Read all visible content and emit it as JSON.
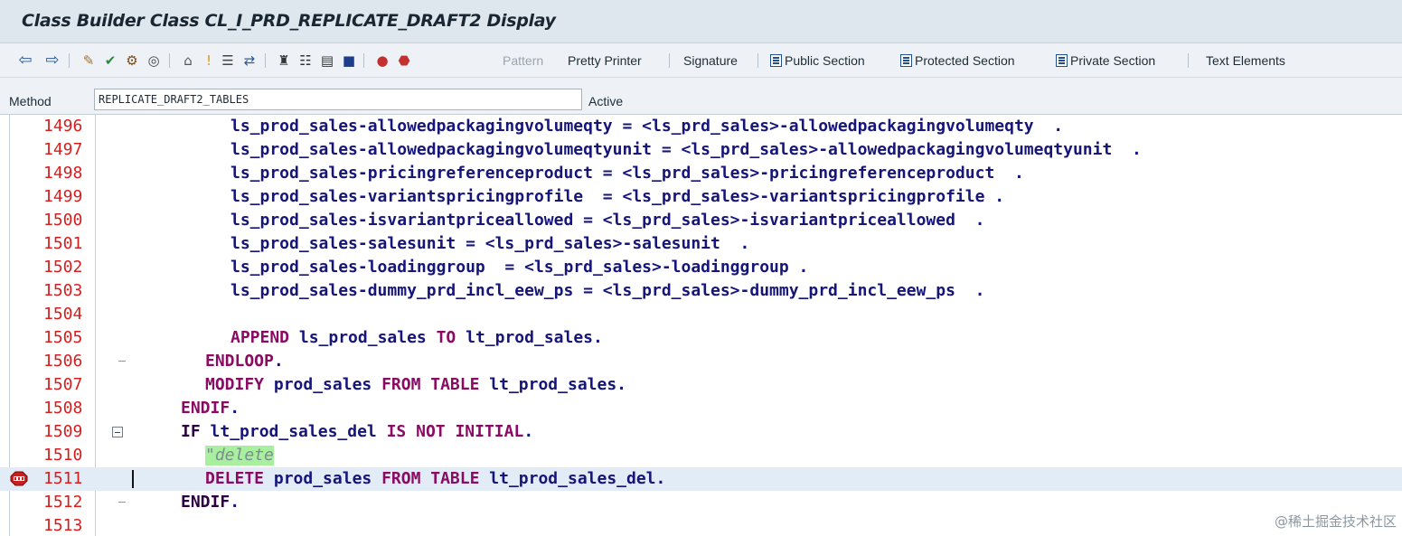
{
  "window": {
    "title": "Class Builder Class CL_I_PRD_REPLICATE_DRAFT2 Display"
  },
  "toolbar": {
    "pattern": "Pattern",
    "pretty_printer": "Pretty Printer",
    "signature": "Signature",
    "public_section": "Public Section",
    "protected_section": "Protected Section",
    "private_section": "Private Section",
    "text_elements": "Text Elements"
  },
  "method": {
    "label": "Method",
    "value": "REPLICATE_DRAFT2_TABLES",
    "status": "Active"
  },
  "code": {
    "lines": [
      {
        "num": "1496",
        "text": "ls_prod_sales-allowedpackagingvolumeqty = <ls_prd_sales>-allowedpackagingvolumeqty  ."
      },
      {
        "num": "1497",
        "text": "ls_prod_sales-allowedpackagingvolumeqtyunit = <ls_prd_sales>-allowedpackagingvolumeqtyunit  ."
      },
      {
        "num": "1498",
        "text": "ls_prod_sales-pricingreferenceproduct = <ls_prd_sales>-pricingreferenceproduct  ."
      },
      {
        "num": "1499",
        "text": "ls_prod_sales-variantspricingprofile  = <ls_prd_sales>-variantspricingprofile ."
      },
      {
        "num": "1500",
        "text": "ls_prod_sales-isvariantpriceallowed = <ls_prd_sales>-isvariantpriceallowed  ."
      },
      {
        "num": "1501",
        "text": "ls_prod_sales-salesunit = <ls_prd_sales>-salesunit  ."
      },
      {
        "num": "1502",
        "text": "ls_prod_sales-loadinggroup  = <ls_prd_sales>-loadinggroup ."
      },
      {
        "num": "1503",
        "text": "ls_prod_sales-dummy_prd_incl_eew_ps = <ls_prd_sales>-dummy_prd_incl_eew_ps  ."
      },
      {
        "num": "1504",
        "text": ""
      },
      {
        "num": "1505",
        "kw1": "APPEND",
        "t1": " ls_prod_sales ",
        "kw2": "TO",
        "t2": " lt_prod_sales."
      },
      {
        "num": "1506",
        "kw1": "ENDLOOP",
        "t1": "."
      },
      {
        "num": "1507",
        "kw1": "MODIFY",
        "t1": " prod_sales ",
        "kw2": "FROM TABLE",
        "t2": " lt_prod_sales."
      },
      {
        "num": "1508",
        "kw1": "ENDIF",
        "t1": "."
      },
      {
        "num": "1509",
        "kw1": "IF",
        "t1": " lt_prod_sales_del ",
        "kw2": "IS NOT INITIAL",
        "t2": "."
      },
      {
        "num": "1510",
        "comment": "\"delete"
      },
      {
        "num": "1511",
        "kw1": "DELETE",
        "t1": " prod_sales ",
        "kw2": "FROM TABLE",
        "t2": " lt_prod_sales_del."
      },
      {
        "num": "1512",
        "kw1": "ENDIF",
        "t1": "."
      },
      {
        "num": "1513",
        "text": ""
      }
    ]
  },
  "watermark": "@稀土掘金技术社区",
  "colors": {
    "line_number": "#d71d1d",
    "keyword": "#8b0a63",
    "identifier": "#15157a",
    "comment_bg": "#a8f0a0",
    "active_line_bg": "#e2ecf6"
  }
}
